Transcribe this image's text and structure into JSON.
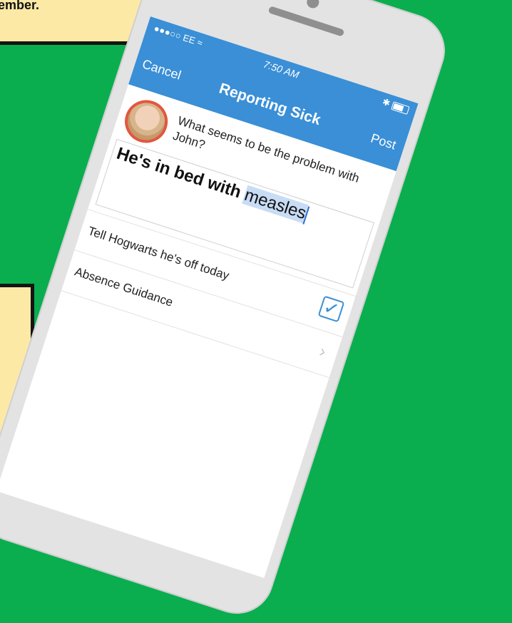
{
  "callout_top": {
    "text": "ember."
  },
  "status": {
    "signal": "●●●○○ EE ≈",
    "time": "7:50 AM",
    "right": "✱"
  },
  "nav": {
    "cancel": "Cancel",
    "title": "Reporting Sick",
    "post": "Post"
  },
  "question": "What seems to be the problem with John?",
  "answer": {
    "prefix": "He's in bed with ",
    "highlight": "measles"
  },
  "rows": [
    {
      "label": "Tell Hogwarts he's off today",
      "checked": true,
      "icon": "checkbox-checked-icon"
    },
    {
      "label": "Absence Guidance",
      "icon": "chevron-right-icon"
    }
  ],
  "colors": {
    "background": "#0aae4f",
    "nav": "#3a8fd6",
    "callout": "#fde9a6",
    "arrow": "#f5b400"
  }
}
